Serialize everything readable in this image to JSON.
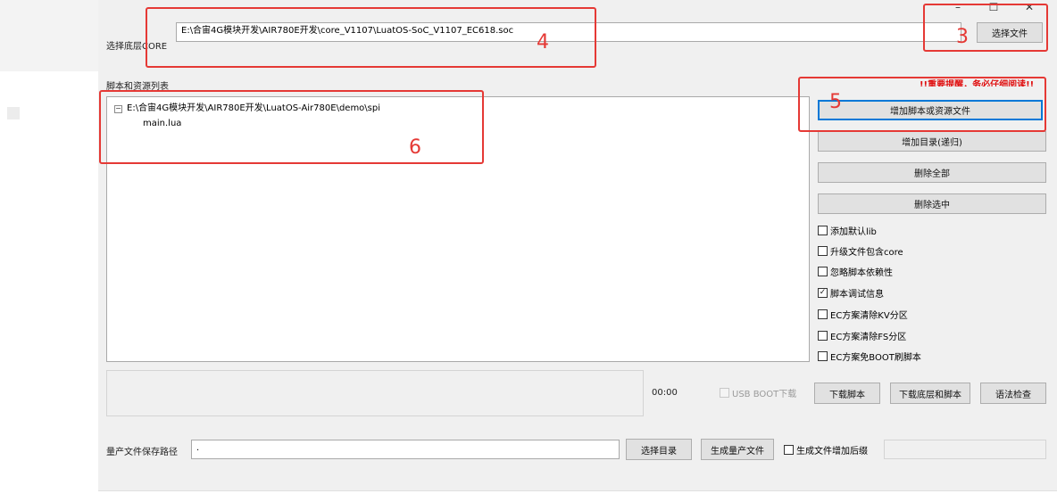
{
  "window_controls": {
    "minimize": "–",
    "maximize": "☐",
    "close": "✕"
  },
  "core": {
    "label": "选择底层CORE",
    "path": "E:\\合宙4G模块开发\\AIR780E开发\\core_V1107\\LuatOS-SoC_V1107_EC618.soc",
    "select_button": "选择文件"
  },
  "scripts": {
    "label": "脚本和资源列表",
    "tree": {
      "root": "E:\\合宙4G模块开发\\AIR780E开发\\LuatOS-Air780E\\demo\\spi",
      "children": [
        "main.lua"
      ],
      "expander": "⊟"
    },
    "warning": "!!重要提醒，务必仔细阅读!!",
    "buttons": {
      "add_file": "增加脚本或资源文件",
      "add_dir": "增加目录(递归)",
      "delete_all": "删除全部",
      "delete_selected": "删除选中"
    },
    "options": [
      {
        "label": "添加默认lib",
        "checked": false
      },
      {
        "label": "升级文件包含core",
        "checked": false
      },
      {
        "label": "忽略脚本依赖性",
        "checked": false
      },
      {
        "label": "脚本调试信息",
        "checked": true
      },
      {
        "label": "EC方案清除KV分区",
        "checked": false
      },
      {
        "label": "EC方案清除FS分区",
        "checked": false
      },
      {
        "label": "EC方案免BOOT刷脚本",
        "checked": false
      }
    ]
  },
  "download": {
    "time": "00:00",
    "usb_boot_label": "USB BOOT下载",
    "download_script": "下载脚本",
    "download_core_script": "下载底层和脚本",
    "syntax_check": "语法检查"
  },
  "production": {
    "label": "量产文件保存路径",
    "path": ".",
    "select_dir": "选择目录",
    "generate": "生成量产文件",
    "suffix_label": "生成文件增加后缀"
  },
  "annotations": {
    "n3": "3",
    "n4": "4",
    "n5": "5",
    "n6": "6",
    "color": "#e53935"
  }
}
